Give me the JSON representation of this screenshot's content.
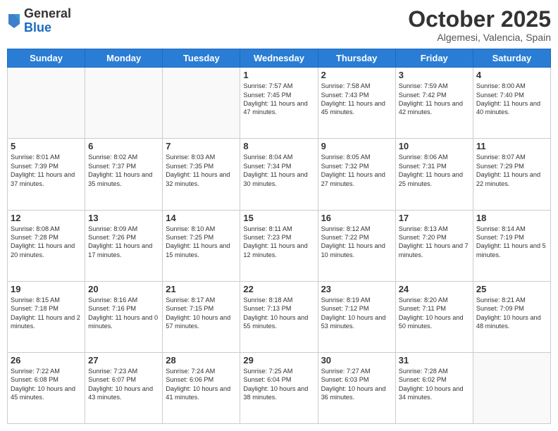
{
  "header": {
    "logo_general": "General",
    "logo_blue": "Blue",
    "month_title": "October 2025",
    "location": "Algemesi, Valencia, Spain"
  },
  "days_of_week": [
    "Sunday",
    "Monday",
    "Tuesday",
    "Wednesday",
    "Thursday",
    "Friday",
    "Saturday"
  ],
  "weeks": [
    [
      {
        "day": "",
        "sunrise": "",
        "sunset": "",
        "daylight": ""
      },
      {
        "day": "",
        "sunrise": "",
        "sunset": "",
        "daylight": ""
      },
      {
        "day": "",
        "sunrise": "",
        "sunset": "",
        "daylight": ""
      },
      {
        "day": "1",
        "sunrise": "Sunrise: 7:57 AM",
        "sunset": "Sunset: 7:45 PM",
        "daylight": "Daylight: 11 hours and 47 minutes."
      },
      {
        "day": "2",
        "sunrise": "Sunrise: 7:58 AM",
        "sunset": "Sunset: 7:43 PM",
        "daylight": "Daylight: 11 hours and 45 minutes."
      },
      {
        "day": "3",
        "sunrise": "Sunrise: 7:59 AM",
        "sunset": "Sunset: 7:42 PM",
        "daylight": "Daylight: 11 hours and 42 minutes."
      },
      {
        "day": "4",
        "sunrise": "Sunrise: 8:00 AM",
        "sunset": "Sunset: 7:40 PM",
        "daylight": "Daylight: 11 hours and 40 minutes."
      }
    ],
    [
      {
        "day": "5",
        "sunrise": "Sunrise: 8:01 AM",
        "sunset": "Sunset: 7:39 PM",
        "daylight": "Daylight: 11 hours and 37 minutes."
      },
      {
        "day": "6",
        "sunrise": "Sunrise: 8:02 AM",
        "sunset": "Sunset: 7:37 PM",
        "daylight": "Daylight: 11 hours and 35 minutes."
      },
      {
        "day": "7",
        "sunrise": "Sunrise: 8:03 AM",
        "sunset": "Sunset: 7:35 PM",
        "daylight": "Daylight: 11 hours and 32 minutes."
      },
      {
        "day": "8",
        "sunrise": "Sunrise: 8:04 AM",
        "sunset": "Sunset: 7:34 PM",
        "daylight": "Daylight: 11 hours and 30 minutes."
      },
      {
        "day": "9",
        "sunrise": "Sunrise: 8:05 AM",
        "sunset": "Sunset: 7:32 PM",
        "daylight": "Daylight: 11 hours and 27 minutes."
      },
      {
        "day": "10",
        "sunrise": "Sunrise: 8:06 AM",
        "sunset": "Sunset: 7:31 PM",
        "daylight": "Daylight: 11 hours and 25 minutes."
      },
      {
        "day": "11",
        "sunrise": "Sunrise: 8:07 AM",
        "sunset": "Sunset: 7:29 PM",
        "daylight": "Daylight: 11 hours and 22 minutes."
      }
    ],
    [
      {
        "day": "12",
        "sunrise": "Sunrise: 8:08 AM",
        "sunset": "Sunset: 7:28 PM",
        "daylight": "Daylight: 11 hours and 20 minutes."
      },
      {
        "day": "13",
        "sunrise": "Sunrise: 8:09 AM",
        "sunset": "Sunset: 7:26 PM",
        "daylight": "Daylight: 11 hours and 17 minutes."
      },
      {
        "day": "14",
        "sunrise": "Sunrise: 8:10 AM",
        "sunset": "Sunset: 7:25 PM",
        "daylight": "Daylight: 11 hours and 15 minutes."
      },
      {
        "day": "15",
        "sunrise": "Sunrise: 8:11 AM",
        "sunset": "Sunset: 7:23 PM",
        "daylight": "Daylight: 11 hours and 12 minutes."
      },
      {
        "day": "16",
        "sunrise": "Sunrise: 8:12 AM",
        "sunset": "Sunset: 7:22 PM",
        "daylight": "Daylight: 11 hours and 10 minutes."
      },
      {
        "day": "17",
        "sunrise": "Sunrise: 8:13 AM",
        "sunset": "Sunset: 7:20 PM",
        "daylight": "Daylight: 11 hours and 7 minutes."
      },
      {
        "day": "18",
        "sunrise": "Sunrise: 8:14 AM",
        "sunset": "Sunset: 7:19 PM",
        "daylight": "Daylight: 11 hours and 5 minutes."
      }
    ],
    [
      {
        "day": "19",
        "sunrise": "Sunrise: 8:15 AM",
        "sunset": "Sunset: 7:18 PM",
        "daylight": "Daylight: 11 hours and 2 minutes."
      },
      {
        "day": "20",
        "sunrise": "Sunrise: 8:16 AM",
        "sunset": "Sunset: 7:16 PM",
        "daylight": "Daylight: 11 hours and 0 minutes."
      },
      {
        "day": "21",
        "sunrise": "Sunrise: 8:17 AM",
        "sunset": "Sunset: 7:15 PM",
        "daylight": "Daylight: 10 hours and 57 minutes."
      },
      {
        "day": "22",
        "sunrise": "Sunrise: 8:18 AM",
        "sunset": "Sunset: 7:13 PM",
        "daylight": "Daylight: 10 hours and 55 minutes."
      },
      {
        "day": "23",
        "sunrise": "Sunrise: 8:19 AM",
        "sunset": "Sunset: 7:12 PM",
        "daylight": "Daylight: 10 hours and 53 minutes."
      },
      {
        "day": "24",
        "sunrise": "Sunrise: 8:20 AM",
        "sunset": "Sunset: 7:11 PM",
        "daylight": "Daylight: 10 hours and 50 minutes."
      },
      {
        "day": "25",
        "sunrise": "Sunrise: 8:21 AM",
        "sunset": "Sunset: 7:09 PM",
        "daylight": "Daylight: 10 hours and 48 minutes."
      }
    ],
    [
      {
        "day": "26",
        "sunrise": "Sunrise: 7:22 AM",
        "sunset": "Sunset: 6:08 PM",
        "daylight": "Daylight: 10 hours and 45 minutes."
      },
      {
        "day": "27",
        "sunrise": "Sunrise: 7:23 AM",
        "sunset": "Sunset: 6:07 PM",
        "daylight": "Daylight: 10 hours and 43 minutes."
      },
      {
        "day": "28",
        "sunrise": "Sunrise: 7:24 AM",
        "sunset": "Sunset: 6:06 PM",
        "daylight": "Daylight: 10 hours and 41 minutes."
      },
      {
        "day": "29",
        "sunrise": "Sunrise: 7:25 AM",
        "sunset": "Sunset: 6:04 PM",
        "daylight": "Daylight: 10 hours and 38 minutes."
      },
      {
        "day": "30",
        "sunrise": "Sunrise: 7:27 AM",
        "sunset": "Sunset: 6:03 PM",
        "daylight": "Daylight: 10 hours and 36 minutes."
      },
      {
        "day": "31",
        "sunrise": "Sunrise: 7:28 AM",
        "sunset": "Sunset: 6:02 PM",
        "daylight": "Daylight: 10 hours and 34 minutes."
      },
      {
        "day": "",
        "sunrise": "",
        "sunset": "",
        "daylight": ""
      }
    ]
  ]
}
